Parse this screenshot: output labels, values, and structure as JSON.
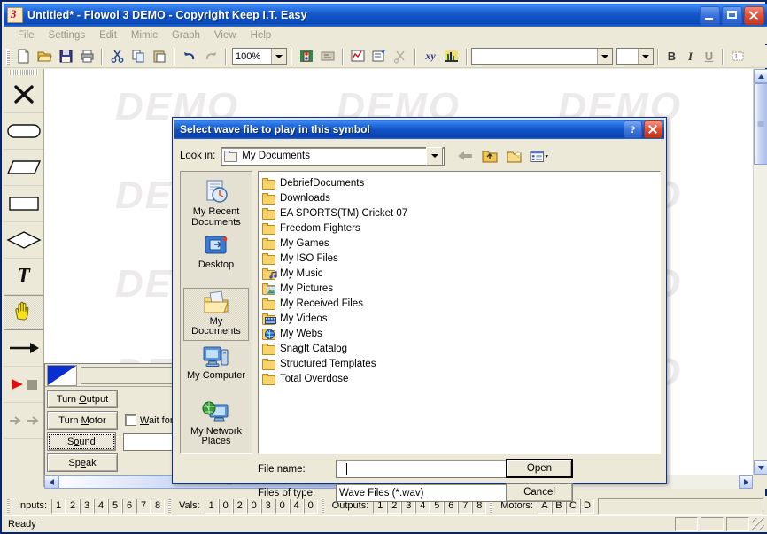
{
  "window": {
    "title": "Untitled* - Flowol 3 DEMO - Copyright Keep I.T. Easy",
    "app_icon": "flowol-icon",
    "minimize": "minimize-button",
    "maximize": "maximize-button",
    "close": "close-button"
  },
  "menu": {
    "items": [
      "File",
      "Settings",
      "Edit",
      "Mimic",
      "Graph",
      "View",
      "Help"
    ]
  },
  "toolbar": {
    "zoom_value": "100%",
    "font_name": "",
    "font_size": "",
    "bold": "B",
    "italic": "I",
    "underline": "U",
    "icons": [
      "new-document-icon",
      "open-folder-icon",
      "save-icon",
      "print-icon",
      "cut-icon",
      "copy-icon",
      "paste-icon",
      "undo-icon",
      "redo-icon",
      "mimic-icon",
      "subroutine-icon",
      "graph-icon",
      "properties-icon",
      "scissors-icon",
      "xy-variable-icon",
      "bar-graph-icon",
      "text-box-icon"
    ]
  },
  "palette": {
    "tools": [
      {
        "name": "delete-tool",
        "glyph": "x-mark"
      },
      {
        "name": "terminal-shape-tool",
        "glyph": "rounded-rect"
      },
      {
        "name": "io-shape-tool",
        "glyph": "parallelogram"
      },
      {
        "name": "process-shape-tool",
        "glyph": "rectangle"
      },
      {
        "name": "decision-shape-tool",
        "glyph": "diamond"
      },
      {
        "name": "text-tool",
        "glyph": "T"
      },
      {
        "name": "hand-pan-tool",
        "glyph": "hand",
        "selected": true
      },
      {
        "name": "connector-arrow-tool",
        "glyph": "arrow"
      },
      {
        "name": "run-stop-tool",
        "glyph": "play-stop"
      },
      {
        "name": "step-tool",
        "glyph": "step-arrows"
      }
    ]
  },
  "canvas": {
    "watermark": "DEMO"
  },
  "subpanel": {
    "buttons": [
      "Turn Output",
      "Turn Motor",
      "Sound",
      "Speak"
    ],
    "checkbox_label": "Wait for",
    "focused_button": "Sound"
  },
  "dialog": {
    "title": "Select wave file to play in this symbol",
    "help_button": "?",
    "close_button": "close-icon",
    "look_in_label": "Look in:",
    "look_in_value": "My Documents",
    "nav_icons": [
      "back-arrow-icon",
      "up-one-level-icon",
      "new-folder-icon",
      "views-dropdown-icon"
    ],
    "places": [
      {
        "label": "My Recent Documents",
        "icon": "recent-documents-icon",
        "selected": false
      },
      {
        "label": "Desktop",
        "icon": "desktop-icon",
        "selected": false
      },
      {
        "label": "My Documents",
        "icon": "my-documents-icon",
        "selected": true
      },
      {
        "label": "My Computer",
        "icon": "my-computer-icon",
        "selected": false
      },
      {
        "label": "My Network Places",
        "icon": "network-places-icon",
        "selected": false
      }
    ],
    "files": [
      {
        "name": "DebriefDocuments",
        "icon": "folder-icon"
      },
      {
        "name": "Downloads",
        "icon": "folder-icon"
      },
      {
        "name": "EA SPORTS(TM) Cricket 07",
        "icon": "folder-icon"
      },
      {
        "name": "Freedom Fighters",
        "icon": "folder-icon"
      },
      {
        "name": "My Games",
        "icon": "folder-icon"
      },
      {
        "name": "My ISO Files",
        "icon": "folder-icon"
      },
      {
        "name": "My Music",
        "icon": "music-folder-icon"
      },
      {
        "name": "My Pictures",
        "icon": "pictures-folder-icon"
      },
      {
        "name": "My Received Files",
        "icon": "folder-icon"
      },
      {
        "name": "My Videos",
        "icon": "videos-folder-icon"
      },
      {
        "name": "My Webs",
        "icon": "webs-folder-icon"
      },
      {
        "name": "SnagIt Catalog",
        "icon": "folder-icon"
      },
      {
        "name": "Structured Templates",
        "icon": "folder-icon"
      },
      {
        "name": "Total Overdose",
        "icon": "folder-icon"
      }
    ],
    "file_name_label": "File name:",
    "file_name_value": "",
    "files_of_type_label": "Files of type:",
    "files_of_type_value": "Wave Files (*.wav)",
    "open_button": "Open",
    "cancel_button": "Cancel"
  },
  "status": {
    "inputs_label": "Inputs:",
    "inputs": [
      "1",
      "2",
      "3",
      "4",
      "5",
      "6",
      "7",
      "8"
    ],
    "vals_label": "Vals:",
    "vals": [
      "1",
      "0",
      "2",
      "0",
      "3",
      "0",
      "4",
      "0"
    ],
    "outputs_label": "Outputs:",
    "outputs": [
      "1",
      "2",
      "3",
      "4",
      "5",
      "6",
      "7",
      "8"
    ],
    "motors_label": "Motors:",
    "motors": [
      "A",
      "B",
      "C",
      "D"
    ],
    "ready_text": "Ready"
  },
  "colors": {
    "title_blue": "#0a5bd3",
    "face": "#ece9d8",
    "dialog_border": "#0831a0",
    "selection": "#316ac5"
  }
}
